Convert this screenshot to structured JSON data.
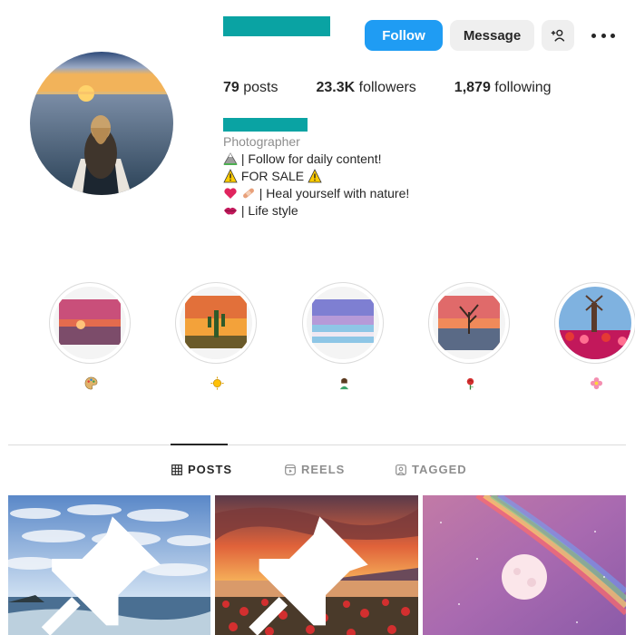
{
  "header": {
    "follow_label": "Follow",
    "message_label": "Message",
    "icons": {
      "add_user": "person-plus-icon",
      "more": "more-horizontal-icon"
    }
  },
  "stats": {
    "posts_count": "79",
    "posts_label": "posts",
    "followers_count": "23.3K",
    "followers_label": "followers",
    "following_count": "1,879",
    "following_label": "following"
  },
  "bio": {
    "category": "Photographer",
    "lines": [
      {
        "icon": "mountain-emoji",
        "text": "| Follow for daily content!"
      },
      {
        "icon": "warning-emoji",
        "text": "FOR SALE",
        "trailing_icon": "warning-emoji"
      },
      {
        "icon": "heart-emoji",
        "icon2": "bandage-emoji",
        "text": "| Heal yourself with nature!"
      },
      {
        "icon": "lips-emoji",
        "text": "| Life style"
      }
    ]
  },
  "highlights": [
    {
      "icon": "palette-emoji"
    },
    {
      "icon": "sun-emoji"
    },
    {
      "icon": "person-emoji"
    },
    {
      "icon": "rose-emoji"
    },
    {
      "icon": "flower-emoji"
    }
  ],
  "tabs": [
    {
      "label": "POSTS",
      "icon": "grid-icon",
      "active": true
    },
    {
      "label": "REELS",
      "icon": "reels-icon",
      "active": false
    },
    {
      "label": "TAGGED",
      "icon": "tagged-icon",
      "active": false
    }
  ],
  "posts": [
    {
      "subject": "cloudy sky over sea",
      "pinned": true
    },
    {
      "subject": "sunset over poppy field",
      "pinned": true
    },
    {
      "subject": "moon with rainbow",
      "pinned": false
    }
  ],
  "colors": {
    "accent": "#1f9cf3",
    "redacted": "#0aa3a3",
    "button_secondary": "#efefef",
    "text": "#262626",
    "muted": "#8e8e8e"
  }
}
